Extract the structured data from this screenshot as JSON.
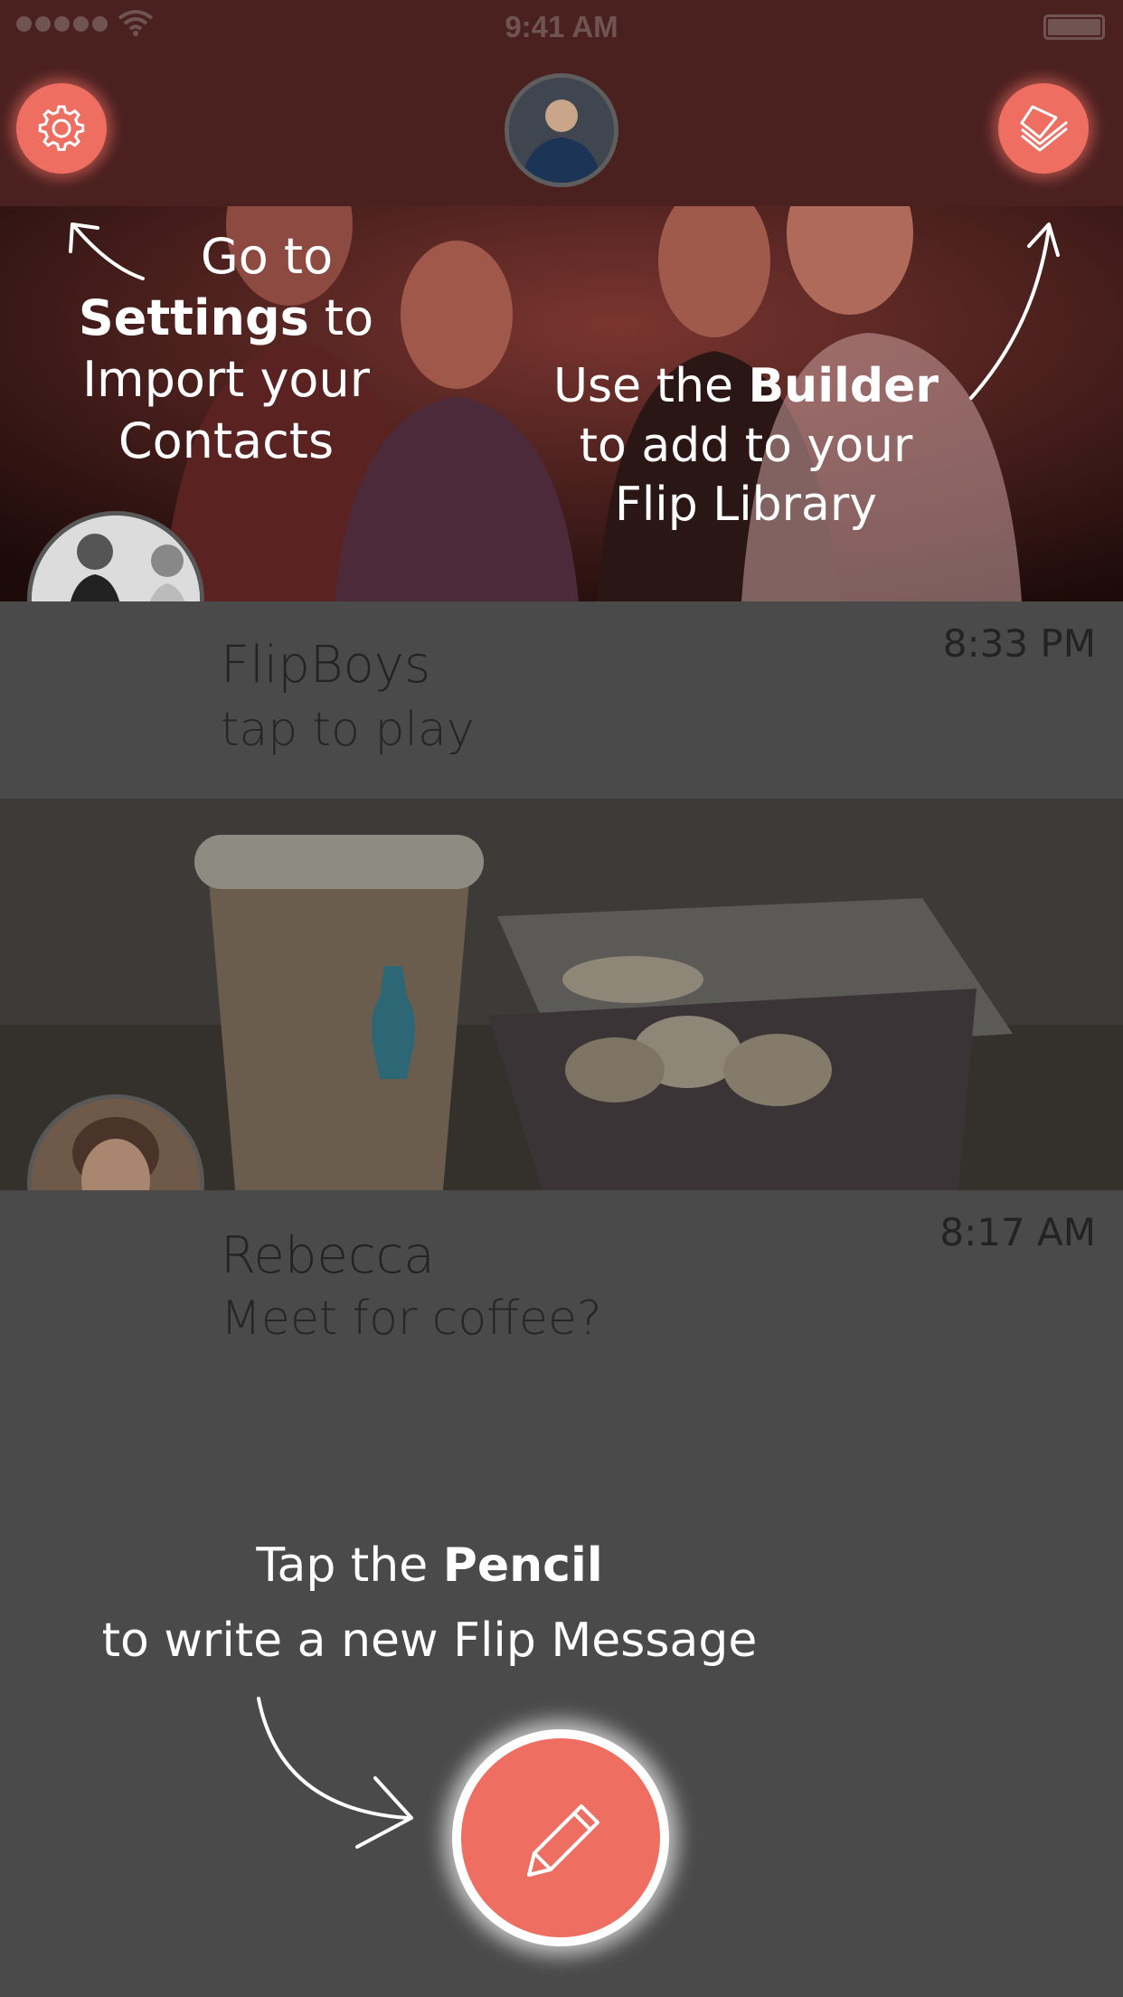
{
  "status_bar": {
    "time": "9:41 AM"
  },
  "header": {
    "icons": {
      "settings": "gear-icon",
      "builder": "stacked-cards-icon"
    },
    "accent_color": "#ee6e62",
    "bar_color": "#4b2120"
  },
  "feed": [
    {
      "name": "FlipBoys",
      "message": "tap to play",
      "time": "8:33 PM"
    },
    {
      "name": "Rebecca",
      "message": "Meet for coffee?",
      "time": "8:17 AM"
    }
  ],
  "coach": {
    "settings": {
      "line1": "Go to",
      "bold": "Settings",
      "after_bold": " to",
      "line3": "Import your",
      "line4": "Contacts"
    },
    "builder": {
      "before_bold": "Use the ",
      "bold": "Builder",
      "line2": "to add to your",
      "line3": "Flip Library"
    },
    "pencil": {
      "before_bold": "Tap the ",
      "bold": "Pencil",
      "line2": "to write a new Flip Message"
    }
  },
  "compose": {
    "icon": "pencil-icon"
  }
}
